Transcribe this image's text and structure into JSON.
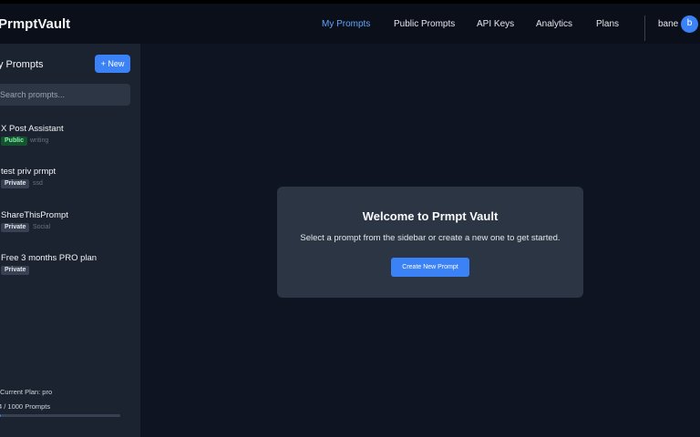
{
  "app": {
    "brand": "PrmptVault"
  },
  "nav": {
    "items": [
      {
        "label": "My Prompts",
        "active": true
      },
      {
        "label": "Public Prompts",
        "active": false
      },
      {
        "label": "API Keys",
        "active": false
      },
      {
        "label": "Analytics",
        "active": false
      },
      {
        "label": "Plans",
        "active": false
      }
    ]
  },
  "user": {
    "name": "bane",
    "avatar_letter": "b"
  },
  "sidebar": {
    "title": "y Prompts",
    "new_label": "+ New",
    "search_placeholder": "Search prompts...",
    "items": [
      {
        "title": "X Post Assistant",
        "visibility": "Public",
        "tag": "writing"
      },
      {
        "title": "test priv prmpt",
        "visibility": "Private",
        "tag": "ssd"
      },
      {
        "title": "ShareThisPrompt",
        "visibility": "Private",
        "tag": "Social"
      },
      {
        "title": "Free 3 months PRO plan",
        "visibility": "Private",
        "tag": ""
      }
    ],
    "plan_text": "Current Plan: pro",
    "count_text": "4 / 1000 Prompts",
    "usage": {
      "used": 4,
      "limit": 1000
    }
  },
  "welcome": {
    "title": "Welcome to Prmpt Vault",
    "text": "Select a prompt from the sidebar or create a new one to get started.",
    "button_label": "Create New Prompt"
  },
  "colors": {
    "accent": "#3b82f6",
    "nav_active": "#60a5fa",
    "public_badge_bg": "#14532d",
    "public_badge_text": "#86efac",
    "private_badge_bg": "#374151"
  }
}
